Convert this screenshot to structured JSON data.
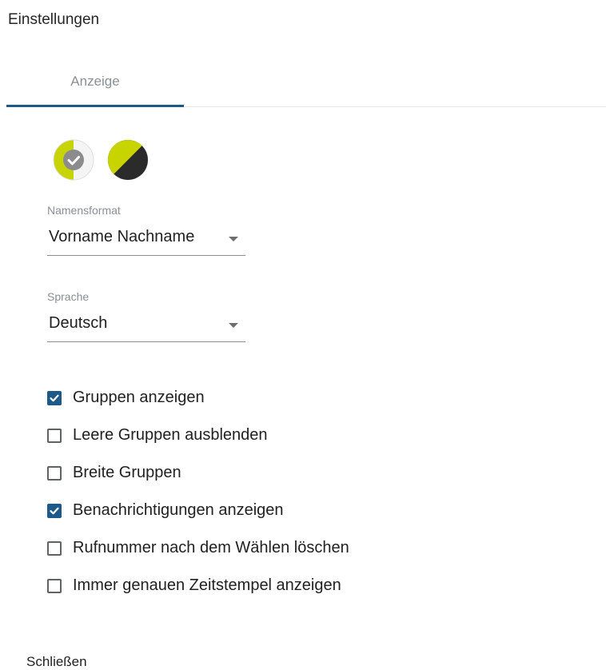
{
  "dialog": {
    "title": "Einstellungen",
    "close_label": "Schließen"
  },
  "tabs": [
    {
      "label": "Anzeige",
      "active": true
    }
  ],
  "themes": [
    {
      "name": "light-theme-swatch",
      "selected": true,
      "colors": [
        "#c8d400",
        "#ffffff",
        "#8a8a8a"
      ]
    },
    {
      "name": "dark-theme-swatch",
      "selected": false,
      "colors": [
        "#c8d400",
        "#2b2b2b"
      ]
    }
  ],
  "name_format": {
    "label": "Namensformat",
    "value": "Vorname Nachname"
  },
  "language": {
    "label": "Sprache",
    "value": "Deutsch"
  },
  "options": [
    {
      "label": "Gruppen anzeigen",
      "checked": true
    },
    {
      "label": "Leere Gruppen ausblenden",
      "checked": false
    },
    {
      "label": "Breite Gruppen",
      "checked": false
    },
    {
      "label": "Benachrichtigungen anzeigen",
      "checked": true
    },
    {
      "label": "Rufnummer nach dem Wählen löschen",
      "checked": false
    },
    {
      "label": "Immer genauen Zeitstempel anzeigen",
      "checked": false
    }
  ],
  "colors": {
    "accent": "#1d5a8a",
    "theme_lime": "#c8d400",
    "theme_dark": "#2b2b2b"
  }
}
